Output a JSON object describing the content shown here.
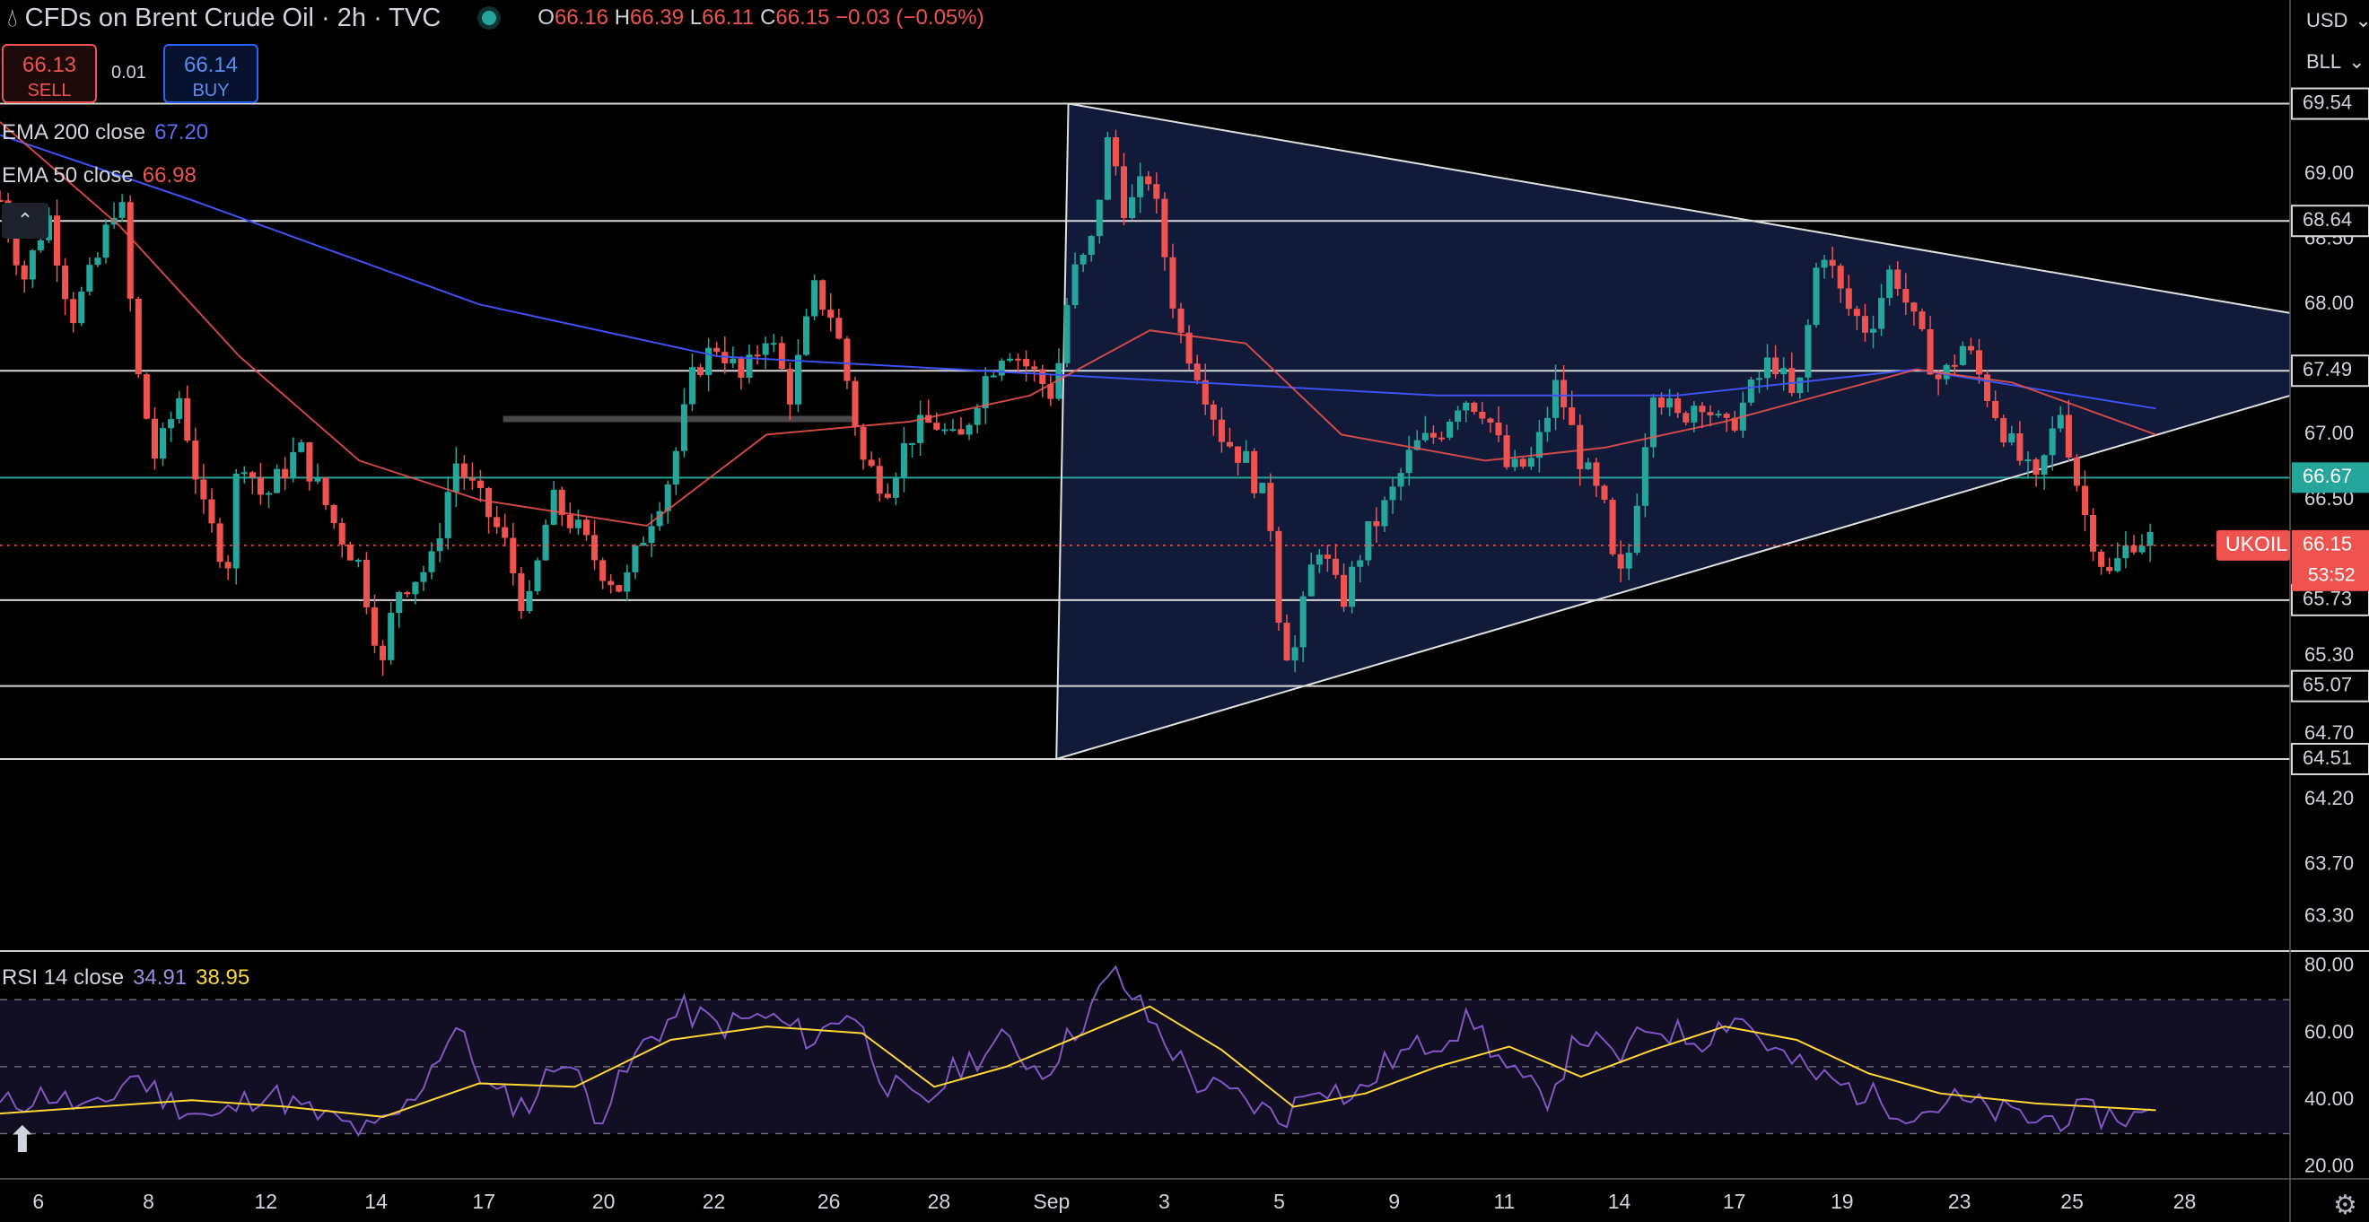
{
  "header": {
    "title": "CFDs on Brent Crude Oil · 2h · TVC",
    "ohlc": {
      "o_label": "O",
      "o": "66.16",
      "h_label": "H",
      "h": "66.39",
      "l_label": "L",
      "l": "66.11",
      "c_label": "C",
      "c": "66.15",
      "change": "−0.03 (−0.05%)"
    }
  },
  "trade": {
    "sell_price": "66.13",
    "sell_label": "SELL",
    "spread": "0.01",
    "buy_price": "66.14",
    "buy_label": "BUY"
  },
  "right_toolbar": {
    "currency": "USD",
    "unit": "BLL"
  },
  "colors": {
    "up": "#26a69a",
    "down": "#ef5350",
    "ema200": "#3f51f0",
    "ema50": "#ef5350",
    "rsi": "#7e57c2",
    "rsi_ma": "#fdd835",
    "triangle_fill": "#111a38",
    "last_price": "#ef5350",
    "green_level": "#26a69a"
  },
  "chart_data": [
    {
      "type": "candlestick",
      "symbol_tag": "UKOIL",
      "last_price": "66.15",
      "countdown": "53:52",
      "x_ticks": [
        "6",
        "8",
        "12",
        "14",
        "17",
        "20",
        "22",
        "26",
        "28",
        "Sep",
        "3",
        "5",
        "9",
        "11",
        "14",
        "17",
        "19",
        "23",
        "25",
        "28"
      ],
      "x_tick_values": [
        1.6,
        6.2,
        11.1,
        15.7,
        20.2,
        25.2,
        29.8,
        34.6,
        39.2,
        43.9,
        48.6,
        53.4,
        58.2,
        62.8,
        67.6,
        72.4,
        76.9,
        81.8,
        86.5,
        91.2
      ],
      "y_ticks": [
        "69.00",
        "68.50",
        "68.00",
        "67.00",
        "66.50",
        "65.30",
        "64.70",
        "64.20",
        "63.70",
        "63.30"
      ],
      "y_tick_values": [
        69.0,
        68.5,
        68.0,
        67.0,
        66.5,
        65.3,
        64.7,
        64.2,
        63.7,
        63.3
      ],
      "horizontal_levels": [
        {
          "label": "69.54",
          "value": 69.54
        },
        {
          "label": "68.64",
          "value": 68.64
        },
        {
          "label": "67.49",
          "value": 67.49
        },
        {
          "label": "66.67",
          "value": 66.67,
          "color": "green"
        },
        {
          "label": "65.73",
          "value": 65.73
        },
        {
          "label": "65.07",
          "value": 65.07
        },
        {
          "label": "64.51",
          "value": 64.51
        }
      ],
      "close_path": [
        [
          0.0,
          68.8
        ],
        [
          1.0,
          68.2
        ],
        [
          2.0,
          68.7
        ],
        [
          3.0,
          67.9
        ],
        [
          4.0,
          68.3
        ],
        [
          5.0,
          68.9
        ],
        [
          5.7,
          67.5
        ],
        [
          6.5,
          66.8
        ],
        [
          7.5,
          67.3
        ],
        [
          8.5,
          66.4
        ],
        [
          9.5,
          66.0
        ],
        [
          10.0,
          66.9
        ],
        [
          11.0,
          66.5
        ],
        [
          12.5,
          66.9
        ],
        [
          14.0,
          66.3
        ],
        [
          15.0,
          66.0
        ],
        [
          16.0,
          65.2
        ],
        [
          16.5,
          65.8
        ],
        [
          18.0,
          66.0
        ],
        [
          19.0,
          66.8
        ],
        [
          20.0,
          66.5
        ],
        [
          21.0,
          66.2
        ],
        [
          22.0,
          65.6
        ],
        [
          23.0,
          66.5
        ],
        [
          24.0,
          66.3
        ],
        [
          25.0,
          66.0
        ],
        [
          26.0,
          65.8
        ],
        [
          27.0,
          66.3
        ],
        [
          28.0,
          66.7
        ],
        [
          29.0,
          67.5
        ],
        [
          30.0,
          67.7
        ],
        [
          31.0,
          67.4
        ],
        [
          32.0,
          67.8
        ],
        [
          33.0,
          67.3
        ],
        [
          34.0,
          68.1
        ],
        [
          34.8,
          67.9
        ],
        [
          35.5,
          67.3
        ],
        [
          36.0,
          66.8
        ],
        [
          37.0,
          66.6
        ],
        [
          38.0,
          67.0
        ],
        [
          39.0,
          67.1
        ],
        [
          40.0,
          66.9
        ],
        [
          41.0,
          67.4
        ],
        [
          42.0,
          67.7
        ],
        [
          43.0,
          67.5
        ],
        [
          44.0,
          67.3
        ],
        [
          44.7,
          68.2
        ],
        [
          45.5,
          68.4
        ],
        [
          46.3,
          69.3
        ],
        [
          47.0,
          68.7
        ],
        [
          48.0,
          69.0
        ],
        [
          48.6,
          68.4
        ],
        [
          49.2,
          67.8
        ],
        [
          50.0,
          67.5
        ],
        [
          51.0,
          67.0
        ],
        [
          52.0,
          66.8
        ],
        [
          53.0,
          66.4
        ],
        [
          53.5,
          65.4
        ],
        [
          54.0,
          65.3
        ],
        [
          55.0,
          66.2
        ],
        [
          56.0,
          65.7
        ],
        [
          57.0,
          66.2
        ],
        [
          58.0,
          66.5
        ],
        [
          59.0,
          66.9
        ],
        [
          60.0,
          67.0
        ],
        [
          61.0,
          67.3
        ],
        [
          62.0,
          67.2
        ],
        [
          63.0,
          66.7
        ],
        [
          64.0,
          66.8
        ],
        [
          65.0,
          67.4
        ],
        [
          66.0,
          66.8
        ],
        [
          67.0,
          66.4
        ],
        [
          67.5,
          65.8
        ],
        [
          68.0,
          66.1
        ],
        [
          69.0,
          67.4
        ],
        [
          70.0,
          67.1
        ],
        [
          71.0,
          67.3
        ],
        [
          72.0,
          67.0
        ],
        [
          73.0,
          67.3
        ],
        [
          74.0,
          67.6
        ],
        [
          75.0,
          67.2
        ],
        [
          76.0,
          68.5
        ],
        [
          77.0,
          68.0
        ],
        [
          78.0,
          67.8
        ],
        [
          79.0,
          68.3
        ],
        [
          80.0,
          67.8
        ],
        [
          81.0,
          67.4
        ],
        [
          82.0,
          67.7
        ],
        [
          83.0,
          67.3
        ],
        [
          84.0,
          66.9
        ],
        [
          85.0,
          66.6
        ],
        [
          86.0,
          67.2
        ],
        [
          87.0,
          66.4
        ],
        [
          88.0,
          65.9
        ],
        [
          89.0,
          66.2
        ],
        [
          90.0,
          66.2
        ]
      ],
      "ema_200": {
        "label": "EMA 200 close",
        "value": "67.20",
        "path": [
          [
            0,
            69.3
          ],
          [
            8,
            68.8
          ],
          [
            20,
            68.0
          ],
          [
            30,
            67.6
          ],
          [
            40,
            67.5
          ],
          [
            50,
            67.4
          ],
          [
            60,
            67.3
          ],
          [
            70,
            67.3
          ],
          [
            80,
            67.5
          ],
          [
            90,
            67.2
          ]
        ]
      },
      "ema_50": {
        "label": "EMA 50 close",
        "value": "66.98",
        "path": [
          [
            0,
            69.4
          ],
          [
            5,
            68.6
          ],
          [
            10,
            67.6
          ],
          [
            15,
            66.8
          ],
          [
            20,
            66.5
          ],
          [
            27,
            66.3
          ],
          [
            32,
            67.0
          ],
          [
            38,
            67.1
          ],
          [
            43,
            67.3
          ],
          [
            48,
            67.8
          ],
          [
            52,
            67.7
          ],
          [
            56,
            67.0
          ],
          [
            62,
            66.8
          ],
          [
            67,
            66.9
          ],
          [
            72,
            67.1
          ],
          [
            76,
            67.3
          ],
          [
            80,
            67.5
          ],
          [
            84,
            67.4
          ],
          [
            90,
            67.0
          ]
        ]
      },
      "triangle": {
        "apex": [
          103.0,
          67.7
        ],
        "top_left": [
          44.6,
          69.54
        ],
        "bottom_left": [
          44.1,
          64.51
        ]
      }
    },
    {
      "type": "line",
      "label": "RSI 14 close",
      "rsi_value": "34.91",
      "ma_value": "38.95",
      "y_ticks": [
        "80.00",
        "60.00",
        "40.00",
        "20.00"
      ],
      "y_tick_values": [
        80,
        60,
        40,
        20
      ],
      "ylim": [
        17,
        84
      ],
      "bands": [
        70,
        50,
        30
      ],
      "rsi_path": [
        [
          0,
          38
        ],
        [
          2,
          42
        ],
        [
          4,
          36
        ],
        [
          5.5,
          48
        ],
        [
          7,
          40
        ],
        [
          9,
          34
        ],
        [
          11,
          43
        ],
        [
          13,
          36
        ],
        [
          15.5,
          30
        ],
        [
          17,
          38
        ],
        [
          19,
          62
        ],
        [
          20.5,
          42
        ],
        [
          22,
          38
        ],
        [
          23.5,
          54
        ],
        [
          25,
          35
        ],
        [
          27,
          58
        ],
        [
          28.5,
          67
        ],
        [
          30,
          62
        ],
        [
          32,
          65
        ],
        [
          34,
          58
        ],
        [
          35.5,
          68
        ],
        [
          37,
          45
        ],
        [
          38.5,
          38
        ],
        [
          40,
          50
        ],
        [
          42,
          58
        ],
        [
          43.5,
          48
        ],
        [
          45,
          62
        ],
        [
          46.5,
          78
        ],
        [
          48,
          64
        ],
        [
          50,
          45
        ],
        [
          52,
          40
        ],
        [
          53.5,
          34
        ],
        [
          55,
          46
        ],
        [
          56.5,
          40
        ],
        [
          58,
          52
        ],
        [
          60,
          58
        ],
        [
          61.5,
          64
        ],
        [
          63,
          48
        ],
        [
          64.5,
          40
        ],
        [
          66,
          60
        ],
        [
          67.5,
          52
        ],
        [
          69,
          62
        ],
        [
          71,
          58
        ],
        [
          72.5,
          66
        ],
        [
          74,
          55
        ],
        [
          75.5,
          48
        ],
        [
          77,
          44
        ],
        [
          78.5,
          40
        ],
        [
          80,
          36
        ],
        [
          81.5,
          40
        ],
        [
          83,
          37
        ],
        [
          85,
          34
        ],
        [
          87,
          36
        ],
        [
          89,
          35
        ],
        [
          90,
          35
        ]
      ],
      "ma_path": [
        [
          0,
          36
        ],
        [
          4,
          38
        ],
        [
          8,
          40
        ],
        [
          12,
          38
        ],
        [
          16,
          35
        ],
        [
          20,
          45
        ],
        [
          24,
          44
        ],
        [
          28,
          58
        ],
        [
          32,
          62
        ],
        [
          36,
          60
        ],
        [
          39,
          44
        ],
        [
          42,
          50
        ],
        [
          46,
          62
        ],
        [
          48,
          68
        ],
        [
          51,
          55
        ],
        [
          54,
          38
        ],
        [
          57,
          42
        ],
        [
          60,
          50
        ],
        [
          63,
          56
        ],
        [
          66,
          47
        ],
        [
          69,
          55
        ],
        [
          72,
          62
        ],
        [
          75,
          58
        ],
        [
          78,
          48
        ],
        [
          81,
          42
        ],
        [
          85,
          39
        ],
        [
          90,
          37
        ]
      ]
    }
  ]
}
